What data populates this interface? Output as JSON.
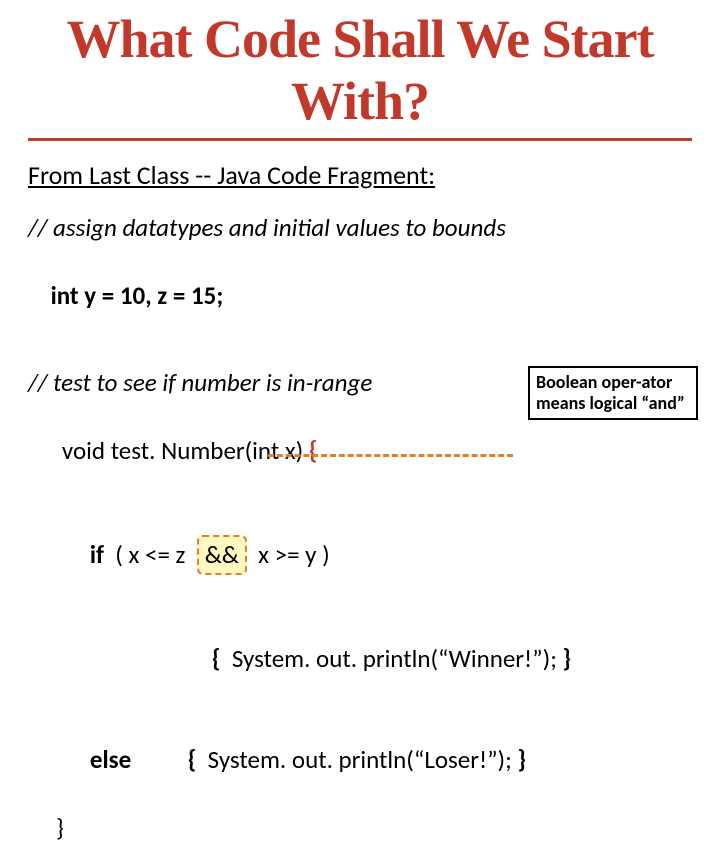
{
  "title": "What Code Shall We Start With?",
  "subtitle": "From Last Class -- Java Code Fragment:",
  "code": {
    "comment1": "// assign datatypes and initial values to bounds",
    "decl_kw": "int",
    "decl_rest": " y = 10, z = 15;",
    "comment2": "// test to see if number is in-range",
    "sig_pre": "void test. Number(int x) ",
    "sig_brace": "{",
    "if_kw": "if",
    "if_cond_a": "  ( x <= z  ",
    "and_op": "&&",
    "if_cond_b": "  x >= y )",
    "then_open": "{",
    "then_body": "  System. out. println(“Winner!”); ",
    "then_close": "}",
    "else_kw": "else",
    "else_open": "{",
    "else_body": "  System. out. println(“Loser!”); ",
    "else_close": "}",
    "final_brace": "}"
  },
  "annotation": "Boolean oper-ator means logical “and”"
}
